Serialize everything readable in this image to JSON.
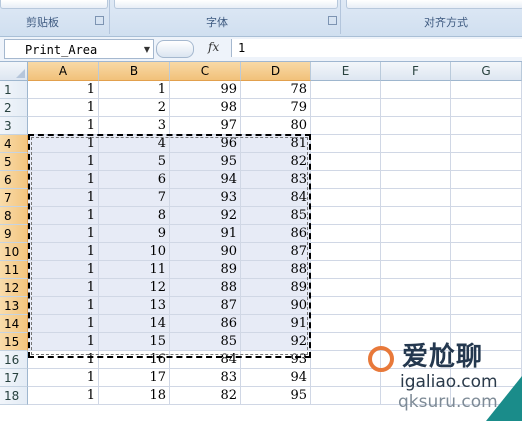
{
  "ribbon": {
    "groups": [
      "剪贴板",
      "字体",
      "对齐方式"
    ]
  },
  "formula_bar": {
    "name_box": "Print_Area",
    "fx_label": "fx",
    "formula": "1"
  },
  "sheet": {
    "columns": [
      "A",
      "B",
      "C",
      "D",
      "E",
      "F",
      "G"
    ],
    "selected_columns": [
      "A",
      "B",
      "C",
      "D"
    ],
    "selected_rows": [
      4,
      15
    ],
    "rows": [
      {
        "n": "1",
        "cells": [
          "1",
          "1",
          "99",
          "78"
        ]
      },
      {
        "n": "2",
        "cells": [
          "1",
          "2",
          "98",
          "79"
        ]
      },
      {
        "n": "3",
        "cells": [
          "1",
          "3",
          "97",
          "80"
        ]
      },
      {
        "n": "4",
        "cells": [
          "1",
          "4",
          "96",
          "81"
        ]
      },
      {
        "n": "5",
        "cells": [
          "1",
          "5",
          "95",
          "82"
        ]
      },
      {
        "n": "6",
        "cells": [
          "1",
          "6",
          "94",
          "83"
        ]
      },
      {
        "n": "7",
        "cells": [
          "1",
          "7",
          "93",
          "84"
        ]
      },
      {
        "n": "8",
        "cells": [
          "1",
          "8",
          "92",
          "85"
        ]
      },
      {
        "n": "9",
        "cells": [
          "1",
          "9",
          "91",
          "86"
        ]
      },
      {
        "n": "10",
        "cells": [
          "1",
          "10",
          "90",
          "87"
        ]
      },
      {
        "n": "11",
        "cells": [
          "1",
          "11",
          "89",
          "88"
        ]
      },
      {
        "n": "12",
        "cells": [
          "1",
          "12",
          "88",
          "89"
        ]
      },
      {
        "n": "13",
        "cells": [
          "1",
          "13",
          "87",
          "90"
        ]
      },
      {
        "n": "14",
        "cells": [
          "1",
          "14",
          "86",
          "91"
        ]
      },
      {
        "n": "15",
        "cells": [
          "1",
          "15",
          "85",
          "92"
        ]
      },
      {
        "n": "16",
        "cells": [
          "1",
          "16",
          "84",
          "93"
        ]
      },
      {
        "n": "17",
        "cells": [
          "1",
          "17",
          "83",
          "94"
        ]
      },
      {
        "n": "18",
        "cells": [
          "1",
          "18",
          "82",
          "95"
        ]
      }
    ]
  },
  "watermark": {
    "zh": "爱尬聊",
    "en": "igaliao.com",
    "small": "qksuru.com"
  },
  "colors": {
    "selection_fill": "#e7ebf6",
    "header_highlight": "#f3c57f",
    "ribbon": "#d0dff0"
  }
}
